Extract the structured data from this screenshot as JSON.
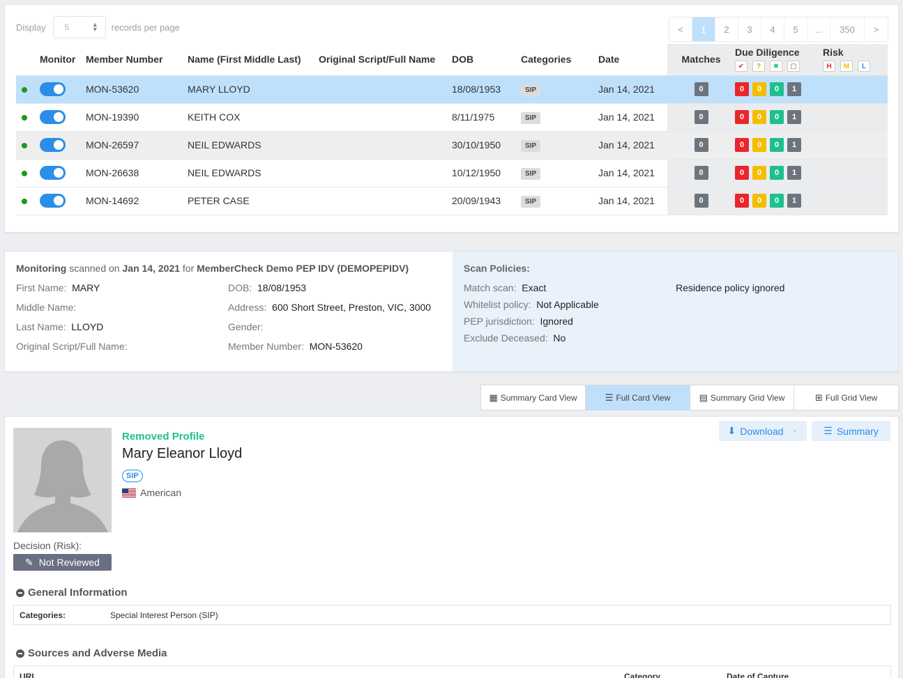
{
  "display": {
    "label": "Display",
    "per_page": "5",
    "suffix": "records per page"
  },
  "pager": [
    "<",
    "1",
    "2",
    "3",
    "4",
    "5",
    "...",
    "350",
    ">"
  ],
  "columns": {
    "monitor": "Monitor",
    "member_number": "Member Number",
    "name": "Name (First Middle Last)",
    "original": "Original Script/Full Name",
    "dob": "DOB",
    "categories": "Categories",
    "date": "Date",
    "matches": "Matches",
    "due_diligence": "Due Diligence",
    "risk": "Risk",
    "risk_levels": [
      "H",
      "M",
      "L"
    ]
  },
  "rows": [
    {
      "num": "MON-53620",
      "name": "MARY LLOYD",
      "original": "",
      "dob": "18/08/1953",
      "cat": "SIP",
      "date": "Jan 14, 2021",
      "matches": "0",
      "dd": [
        "0",
        "0",
        "0",
        "1"
      ]
    },
    {
      "num": "MON-19390",
      "name": "KEITH COX",
      "original": "",
      "dob": "8/11/1975",
      "cat": "SIP",
      "date": "Jan 14, 2021",
      "matches": "0",
      "dd": [
        "0",
        "0",
        "0",
        "1"
      ]
    },
    {
      "num": "MON-26597",
      "name": "NEIL EDWARDS",
      "original": "",
      "dob": "30/10/1950",
      "cat": "SIP",
      "date": "Jan 14, 2021",
      "matches": "0",
      "dd": [
        "0",
        "0",
        "0",
        "1"
      ]
    },
    {
      "num": "MON-26638",
      "name": "NEIL EDWARDS",
      "original": "",
      "dob": "10/12/1950",
      "cat": "SIP",
      "date": "Jan 14, 2021",
      "matches": "0",
      "dd": [
        "0",
        "0",
        "0",
        "1"
      ]
    },
    {
      "num": "MON-14692",
      "name": "PETER CASE",
      "original": "",
      "dob": "20/09/1943",
      "cat": "SIP",
      "date": "Jan 14, 2021",
      "matches": "0",
      "dd": [
        "0",
        "0",
        "0",
        "1"
      ]
    }
  ],
  "info": {
    "monitoring": "Monitoring",
    "scanned_on": "scanned on",
    "scan_date": "Jan 14, 2021",
    "for": "for",
    "org": "MemberCheck Demo PEP IDV (DEMOPEPIDV)",
    "first_name_label": "First Name:",
    "first_name": "MARY",
    "middle_name_label": "Middle Name:",
    "middle_name": "",
    "last_name_label": "Last Name:",
    "last_name": "LLOYD",
    "original_label": "Original Script/Full Name:",
    "original": "",
    "dob_label": "DOB:",
    "dob": "18/08/1953",
    "address_label": "Address:",
    "address": "600 Short Street, Preston, VIC, 3000",
    "gender_label": "Gender:",
    "gender": "",
    "member_number_label": "Member Number:",
    "member_number": "MON-53620"
  },
  "policies": {
    "title": "Scan Policies:",
    "match_scan_label": "Match scan:",
    "match_scan": "Exact",
    "whitelist_label": "Whitelist policy:",
    "whitelist": "Not Applicable",
    "pep_label": "PEP jurisdiction:",
    "pep": "Ignored",
    "deceased_label": "Exclude Deceased:",
    "deceased": "No",
    "residence": "Residence policy ignored"
  },
  "views": [
    "Summary Card View",
    "Full Card View",
    "Summary Grid View",
    "Full Grid View"
  ],
  "profile": {
    "status": "Removed Profile",
    "full_name": "Mary Eleanor Lloyd",
    "badge": "SIP",
    "nationality": "American",
    "download": "Download",
    "summary": "Summary",
    "decision_label": "Decision (Risk):",
    "decision": "Not Reviewed",
    "general_title": "General Information",
    "categories_label": "Categories:",
    "categories_value": "Special Interest Person (SIP)",
    "sources_title": "Sources and Adverse Media",
    "sources_cols": [
      "URL",
      "Category",
      "Date of Capture"
    ]
  },
  "colors": {
    "accent": "#2b8ee8",
    "selected_row": "#bfe0fb",
    "removed": "#1fbf8f"
  }
}
